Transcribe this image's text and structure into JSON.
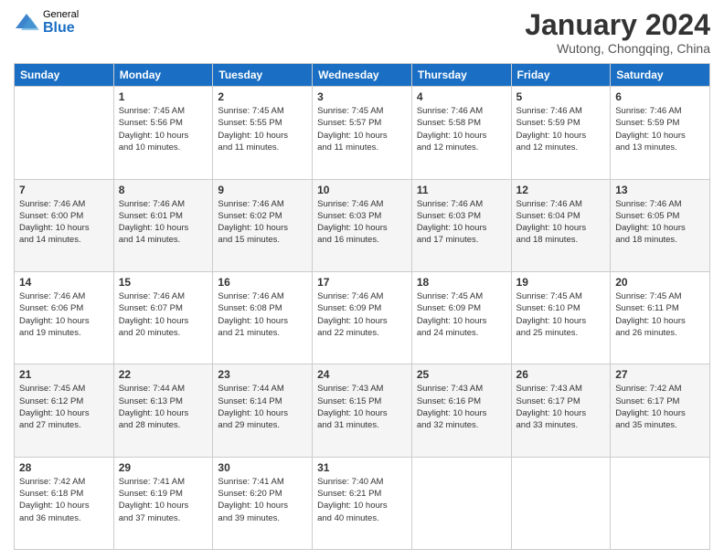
{
  "logo": {
    "general": "General",
    "blue": "Blue"
  },
  "header": {
    "month": "January 2024",
    "location": "Wutong, Chongqing, China"
  },
  "days_of_week": [
    "Sunday",
    "Monday",
    "Tuesday",
    "Wednesday",
    "Thursday",
    "Friday",
    "Saturday"
  ],
  "weeks": [
    [
      {
        "day": "",
        "sunrise": "",
        "sunset": "",
        "daylight": ""
      },
      {
        "day": "1",
        "sunrise": "7:45 AM",
        "sunset": "5:56 PM",
        "daylight": "10 hours and 10 minutes."
      },
      {
        "day": "2",
        "sunrise": "7:45 AM",
        "sunset": "5:55 PM",
        "daylight": "10 hours and 11 minutes."
      },
      {
        "day": "3",
        "sunrise": "7:45 AM",
        "sunset": "5:57 PM",
        "daylight": "10 hours and 11 minutes."
      },
      {
        "day": "4",
        "sunrise": "7:46 AM",
        "sunset": "5:58 PM",
        "daylight": "10 hours and 12 minutes."
      },
      {
        "day": "5",
        "sunrise": "7:46 AM",
        "sunset": "5:59 PM",
        "daylight": "10 hours and 12 minutes."
      },
      {
        "day": "6",
        "sunrise": "7:46 AM",
        "sunset": "5:59 PM",
        "daylight": "10 hours and 13 minutes."
      }
    ],
    [
      {
        "day": "7",
        "sunrise": "7:46 AM",
        "sunset": "6:00 PM",
        "daylight": "10 hours and 14 minutes."
      },
      {
        "day": "8",
        "sunrise": "7:46 AM",
        "sunset": "6:01 PM",
        "daylight": "10 hours and 14 minutes."
      },
      {
        "day": "9",
        "sunrise": "7:46 AM",
        "sunset": "6:02 PM",
        "daylight": "10 hours and 15 minutes."
      },
      {
        "day": "10",
        "sunrise": "7:46 AM",
        "sunset": "6:03 PM",
        "daylight": "10 hours and 16 minutes."
      },
      {
        "day": "11",
        "sunrise": "7:46 AM",
        "sunset": "6:03 PM",
        "daylight": "10 hours and 17 minutes."
      },
      {
        "day": "12",
        "sunrise": "7:46 AM",
        "sunset": "6:04 PM",
        "daylight": "10 hours and 18 minutes."
      },
      {
        "day": "13",
        "sunrise": "7:46 AM",
        "sunset": "6:05 PM",
        "daylight": "10 hours and 18 minutes."
      }
    ],
    [
      {
        "day": "14",
        "sunrise": "7:46 AM",
        "sunset": "6:06 PM",
        "daylight": "10 hours and 19 minutes."
      },
      {
        "day": "15",
        "sunrise": "7:46 AM",
        "sunset": "6:07 PM",
        "daylight": "10 hours and 20 minutes."
      },
      {
        "day": "16",
        "sunrise": "7:46 AM",
        "sunset": "6:08 PM",
        "daylight": "10 hours and 21 minutes."
      },
      {
        "day": "17",
        "sunrise": "7:46 AM",
        "sunset": "6:09 PM",
        "daylight": "10 hours and 22 minutes."
      },
      {
        "day": "18",
        "sunrise": "7:45 AM",
        "sunset": "6:09 PM",
        "daylight": "10 hours and 24 minutes."
      },
      {
        "day": "19",
        "sunrise": "7:45 AM",
        "sunset": "6:10 PM",
        "daylight": "10 hours and 25 minutes."
      },
      {
        "day": "20",
        "sunrise": "7:45 AM",
        "sunset": "6:11 PM",
        "daylight": "10 hours and 26 minutes."
      }
    ],
    [
      {
        "day": "21",
        "sunrise": "7:45 AM",
        "sunset": "6:12 PM",
        "daylight": "10 hours and 27 minutes."
      },
      {
        "day": "22",
        "sunrise": "7:44 AM",
        "sunset": "6:13 PM",
        "daylight": "10 hours and 28 minutes."
      },
      {
        "day": "23",
        "sunrise": "7:44 AM",
        "sunset": "6:14 PM",
        "daylight": "10 hours and 29 minutes."
      },
      {
        "day": "24",
        "sunrise": "7:43 AM",
        "sunset": "6:15 PM",
        "daylight": "10 hours and 31 minutes."
      },
      {
        "day": "25",
        "sunrise": "7:43 AM",
        "sunset": "6:16 PM",
        "daylight": "10 hours and 32 minutes."
      },
      {
        "day": "26",
        "sunrise": "7:43 AM",
        "sunset": "6:17 PM",
        "daylight": "10 hours and 33 minutes."
      },
      {
        "day": "27",
        "sunrise": "7:42 AM",
        "sunset": "6:17 PM",
        "daylight": "10 hours and 35 minutes."
      }
    ],
    [
      {
        "day": "28",
        "sunrise": "7:42 AM",
        "sunset": "6:18 PM",
        "daylight": "10 hours and 36 minutes."
      },
      {
        "day": "29",
        "sunrise": "7:41 AM",
        "sunset": "6:19 PM",
        "daylight": "10 hours and 37 minutes."
      },
      {
        "day": "30",
        "sunrise": "7:41 AM",
        "sunset": "6:20 PM",
        "daylight": "10 hours and 39 minutes."
      },
      {
        "day": "31",
        "sunrise": "7:40 AM",
        "sunset": "6:21 PM",
        "daylight": "10 hours and 40 minutes."
      },
      {
        "day": "",
        "sunrise": "",
        "sunset": "",
        "daylight": ""
      },
      {
        "day": "",
        "sunrise": "",
        "sunset": "",
        "daylight": ""
      },
      {
        "day": "",
        "sunrise": "",
        "sunset": "",
        "daylight": ""
      }
    ]
  ],
  "labels": {
    "sunrise": "Sunrise:",
    "sunset": "Sunset:",
    "daylight": "Daylight:"
  }
}
